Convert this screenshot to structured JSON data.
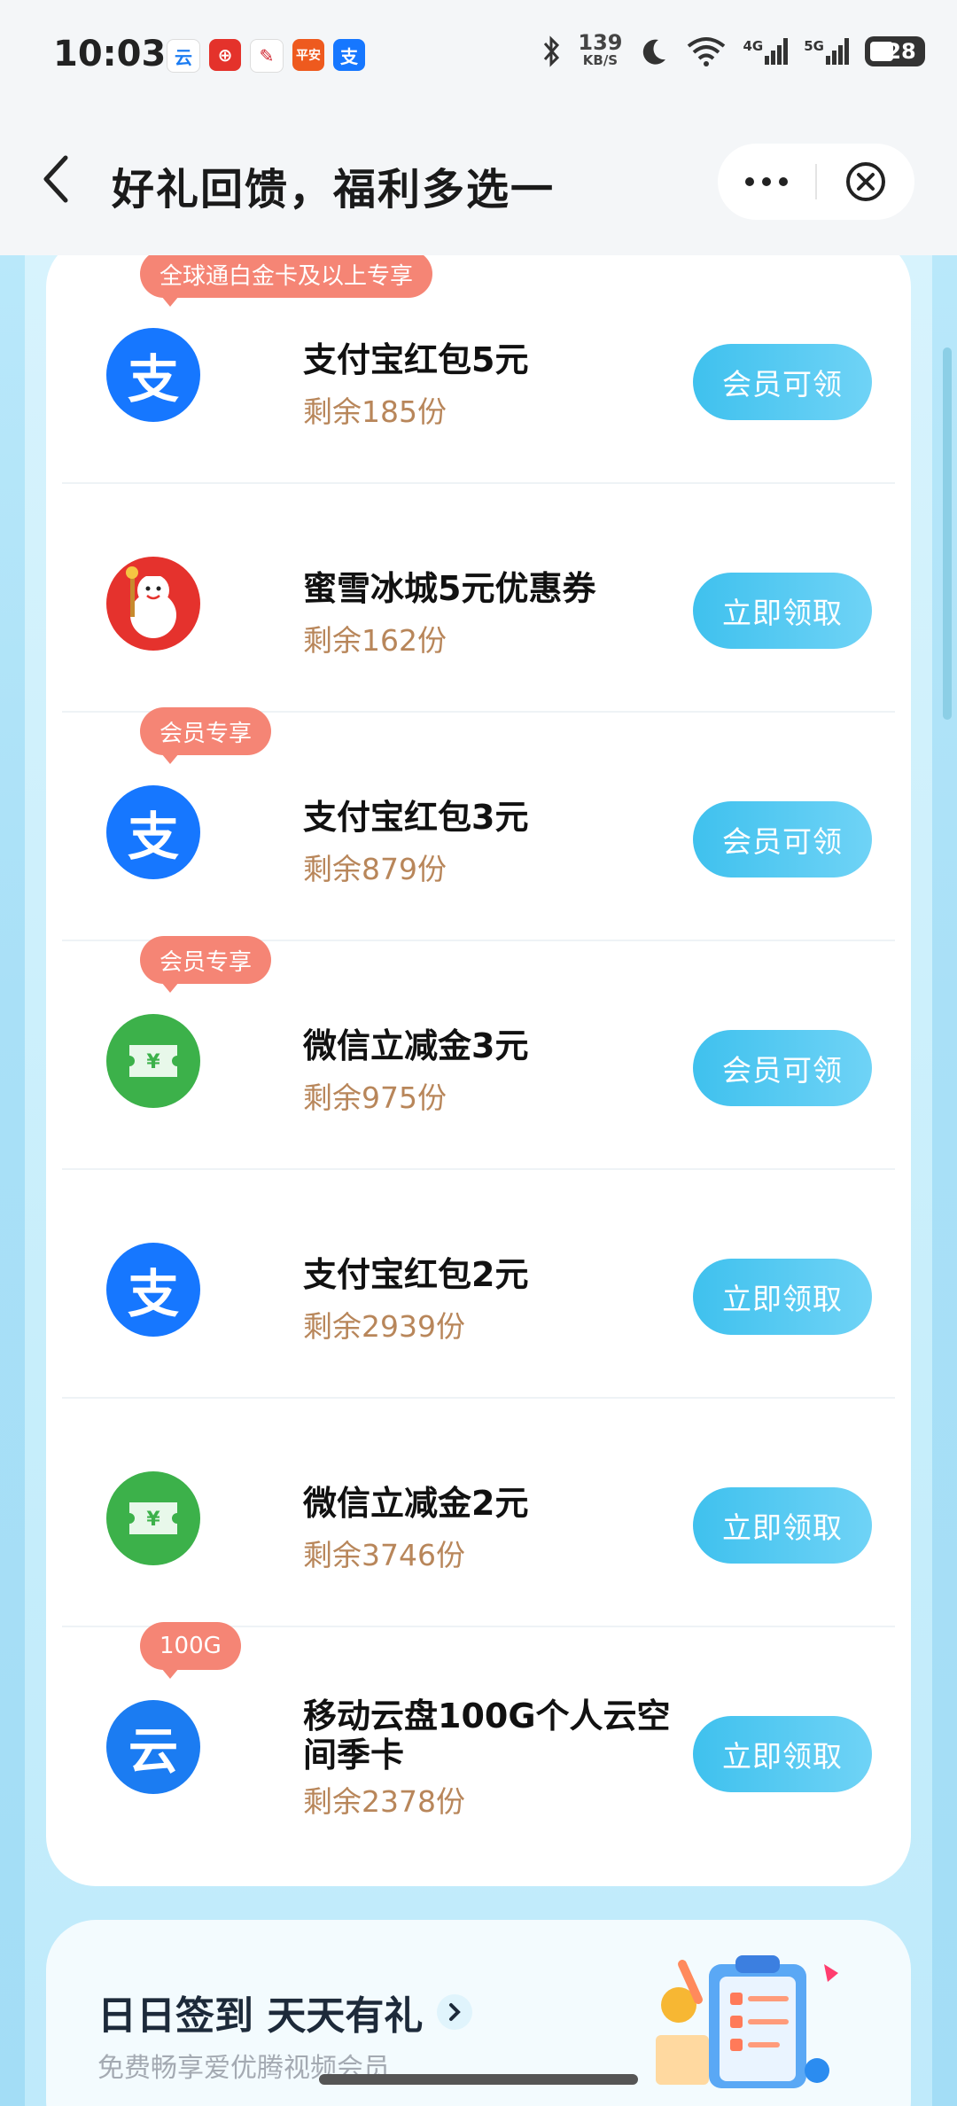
{
  "status_bar": {
    "time": "10:03",
    "net_speed_value": "139",
    "net_speed_unit": "KB/S",
    "net4g": "4G",
    "net5g": "5G",
    "battery": "28",
    "notif_icons": [
      "cloud-icon",
      "lottery-icon",
      "app-icon",
      "pingan-bank-icon",
      "alipay-icon"
    ]
  },
  "nav": {
    "title": "好礼回馈，福利多选一"
  },
  "rewards": [
    {
      "badge": "全球通白金卡及以上专享",
      "icon": "alipay-icon",
      "title": "支付宝红包5元",
      "remaining": "剩余185份",
      "button": "会员可领"
    },
    {
      "badge": "",
      "icon": "mixue-icon",
      "title": "蜜雪冰城5元优惠券",
      "remaining": "剩余162份",
      "button": "立即领取"
    },
    {
      "badge": "会员专享",
      "icon": "alipay-icon",
      "title": "支付宝红包3元",
      "remaining": "剩余879份",
      "button": "会员可领"
    },
    {
      "badge": "会员专享",
      "icon": "wechat-coupon-icon",
      "title": "微信立减金3元",
      "remaining": "剩余975份",
      "button": "会员可领"
    },
    {
      "badge": "",
      "icon": "alipay-icon",
      "title": "支付宝红包2元",
      "remaining": "剩余2939份",
      "button": "立即领取"
    },
    {
      "badge": "",
      "icon": "wechat-coupon-icon",
      "title": "微信立减金2元",
      "remaining": "剩余3746份",
      "button": "立即领取"
    },
    {
      "badge": "100G",
      "icon": "cloud-drive-icon",
      "title": "移动云盘100G个人云空间季卡",
      "remaining": "剩余2378份",
      "button": "立即领取"
    }
  ],
  "signin": {
    "title": "日日签到 天天有礼",
    "subtitle": "免费畅享爱优腾视频会员"
  },
  "colors": {
    "button_gradient_start": "#3fc1ee",
    "badge": "#f58575",
    "remaining_text": "#b8865a",
    "alipay_blue": "#1677ff",
    "wechat_green": "#3cb14a"
  }
}
